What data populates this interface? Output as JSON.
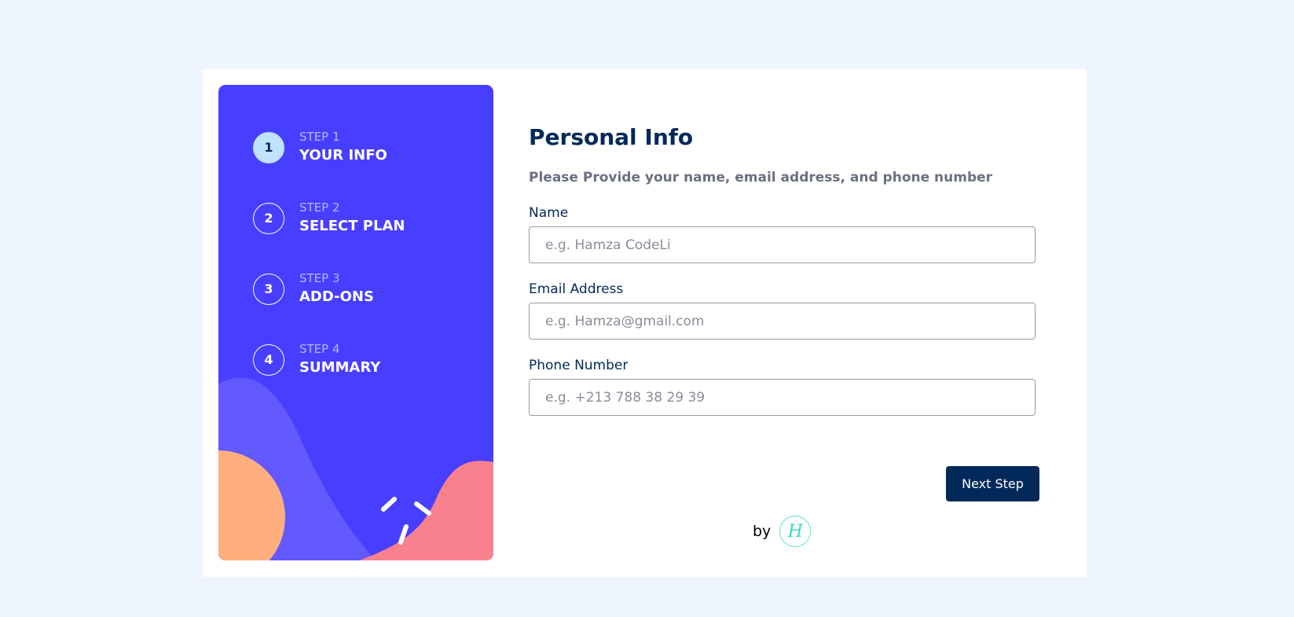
{
  "sidebar": {
    "steps": [
      {
        "number": "1",
        "label": "STEP 1",
        "title": "YOUR INFO",
        "active": true
      },
      {
        "number": "2",
        "label": "STEP 2",
        "title": "SELECT PLAN",
        "active": false
      },
      {
        "number": "3",
        "label": "STEP 3",
        "title": "ADD-ONS",
        "active": false
      },
      {
        "number": "4",
        "label": "STEP 4",
        "title": "SUMMARY",
        "active": false
      }
    ]
  },
  "form": {
    "title": "Personal Info",
    "subtitle": "Please Provide your name, email address, and phone number",
    "fields": [
      {
        "label": "Name",
        "placeholder": "e.g. Hamza CodeLi",
        "value": ""
      },
      {
        "label": "Email Address",
        "placeholder": "e.g. Hamza@gmail.com",
        "value": ""
      },
      {
        "label": "Phone Number",
        "placeholder": "e.g. +213 788 38 29 39",
        "value": ""
      }
    ],
    "next_label": "Next Step"
  },
  "credit": {
    "text": "by",
    "logo_glyph": "H"
  },
  "colors": {
    "page_bg": "#eef5ff",
    "sidebar_bg": "#483eff",
    "active_step": "#bfe2fd",
    "primary_dark": "#02295a",
    "decor_orange": "#ffaf7e",
    "decor_pink": "#f9818e",
    "decor_violet": "#6259ff"
  }
}
